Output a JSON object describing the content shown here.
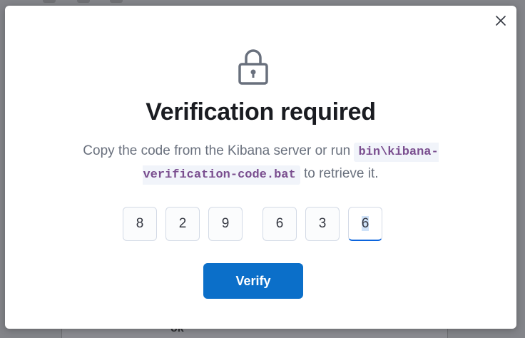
{
  "modal": {
    "title": "Verification required",
    "description_before": "Copy the code from the Kibana server or run ",
    "command": "bin\\kibana-verification-code.bat",
    "description_after": " to retrieve it.",
    "close_icon": "close-icon",
    "lock_icon": "lock-icon"
  },
  "code_digits": [
    "8",
    "2",
    "9",
    "6",
    "3",
    "6"
  ],
  "verify_button": {
    "label": "Verify"
  },
  "background": {
    "panel_text": "ok"
  },
  "colors": {
    "accent": "#0b6fc9",
    "code_text": "#7a4e8f",
    "title": "#1a1c21",
    "body_text": "#69707d"
  }
}
